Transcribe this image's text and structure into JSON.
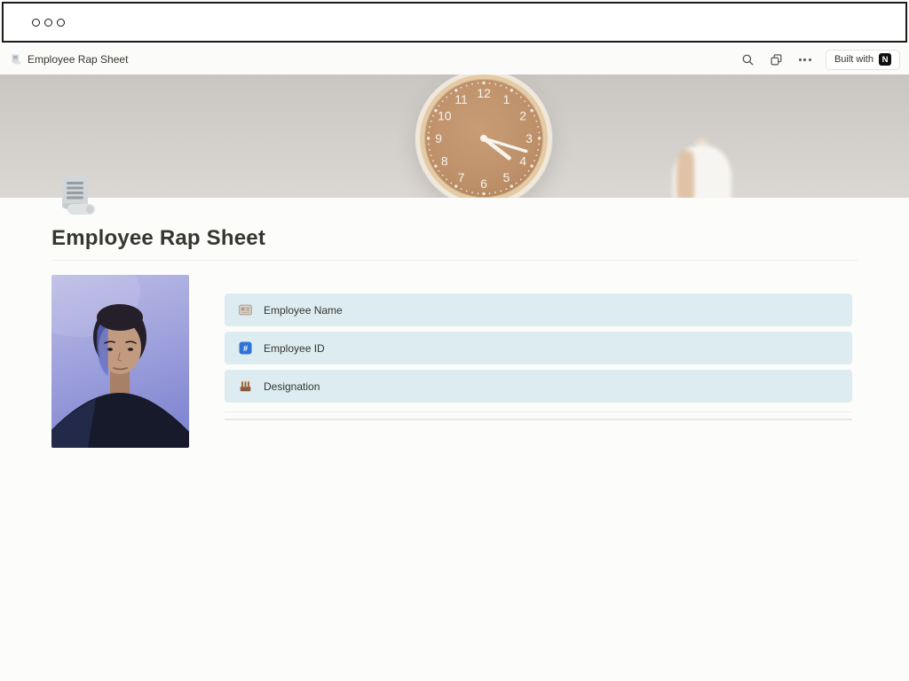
{
  "window": {
    "controls_count": 3
  },
  "toolbar": {
    "title": "Employee Rap Sheet",
    "built_with": {
      "label": "Built with",
      "logo_letter": "N"
    }
  },
  "cover": {
    "description": "Wooden wall clock on a warm gray wall with a white lamp at lower right",
    "clock": {
      "numerals": [
        "12",
        "1",
        "2",
        "3",
        "4",
        "5",
        "6",
        "7",
        "8",
        "9",
        "10",
        "11"
      ],
      "time_shown": "4:18"
    }
  },
  "page": {
    "icon": "receipt-icon",
    "title": "Employee Rap Sheet",
    "photo": {
      "description": "Portrait of a person with dark pulled-back hair, dark top, blue-purple backdrop"
    },
    "fields": [
      {
        "icon": "name-badge-icon",
        "label": "Employee Name"
      },
      {
        "icon": "id-number-icon",
        "label": "Employee ID"
      },
      {
        "icon": "designation-icon",
        "label": "Designation"
      }
    ]
  },
  "colors": {
    "field_background": "#ddecf1",
    "id_icon_blue": "#2e74d4",
    "text": "#37352f",
    "page_background": "#fbfbfa",
    "clock_face": "#c0946d"
  }
}
